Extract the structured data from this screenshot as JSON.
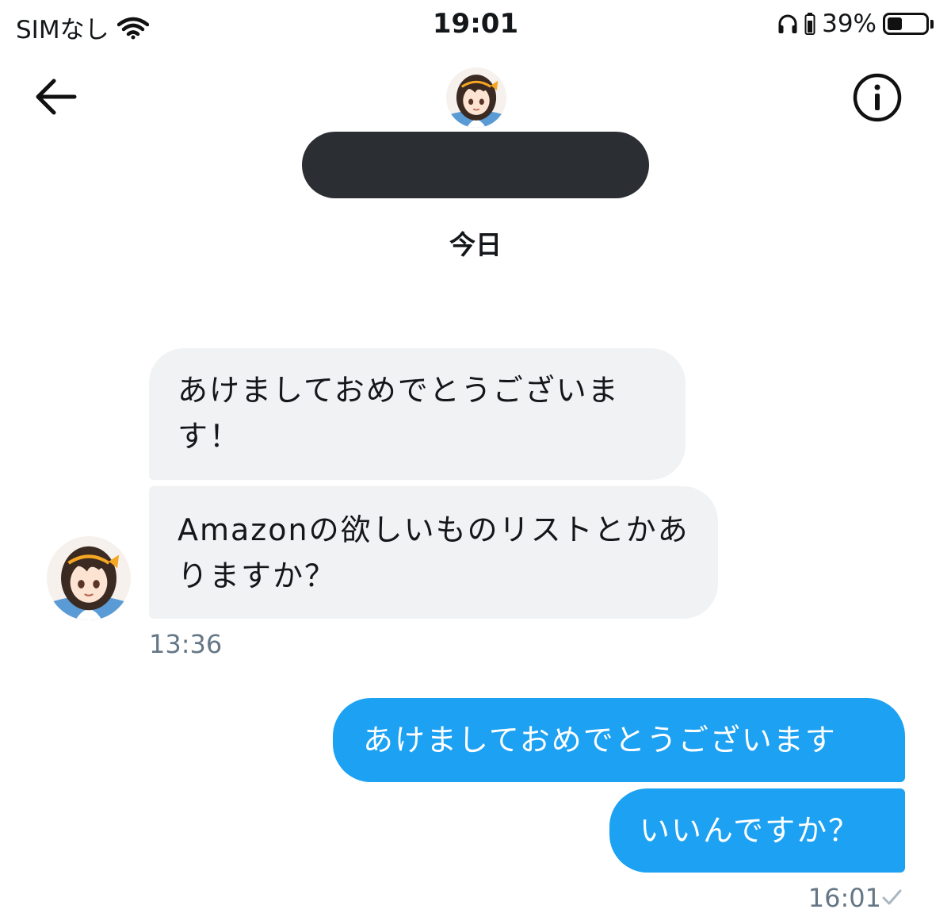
{
  "status_bar": {
    "carrier": "SIMなし",
    "time": "19:01",
    "battery_percent": "39%",
    "battery_level": 0.39
  },
  "header": {
    "day_label": "今日",
    "back_icon": "arrow-left-icon",
    "info_icon": "info-circle-icon"
  },
  "messages": [
    {
      "direction": "incoming",
      "text": "あけましておめでとうございます！"
    },
    {
      "direction": "incoming",
      "text": "Amazonの欲しいものリストとかありますか？"
    },
    {
      "direction": "outgoing",
      "text": "あけましておめでとうございます"
    },
    {
      "direction": "outgoing",
      "text": "いいんですか？"
    }
  ],
  "timestamps": {
    "incoming": "13:36",
    "outgoing": "16:01"
  },
  "colors": {
    "incoming_bubble": "#f0f2f4",
    "outgoing_bubble": "#1da1f2",
    "timestamp": "#657786"
  }
}
